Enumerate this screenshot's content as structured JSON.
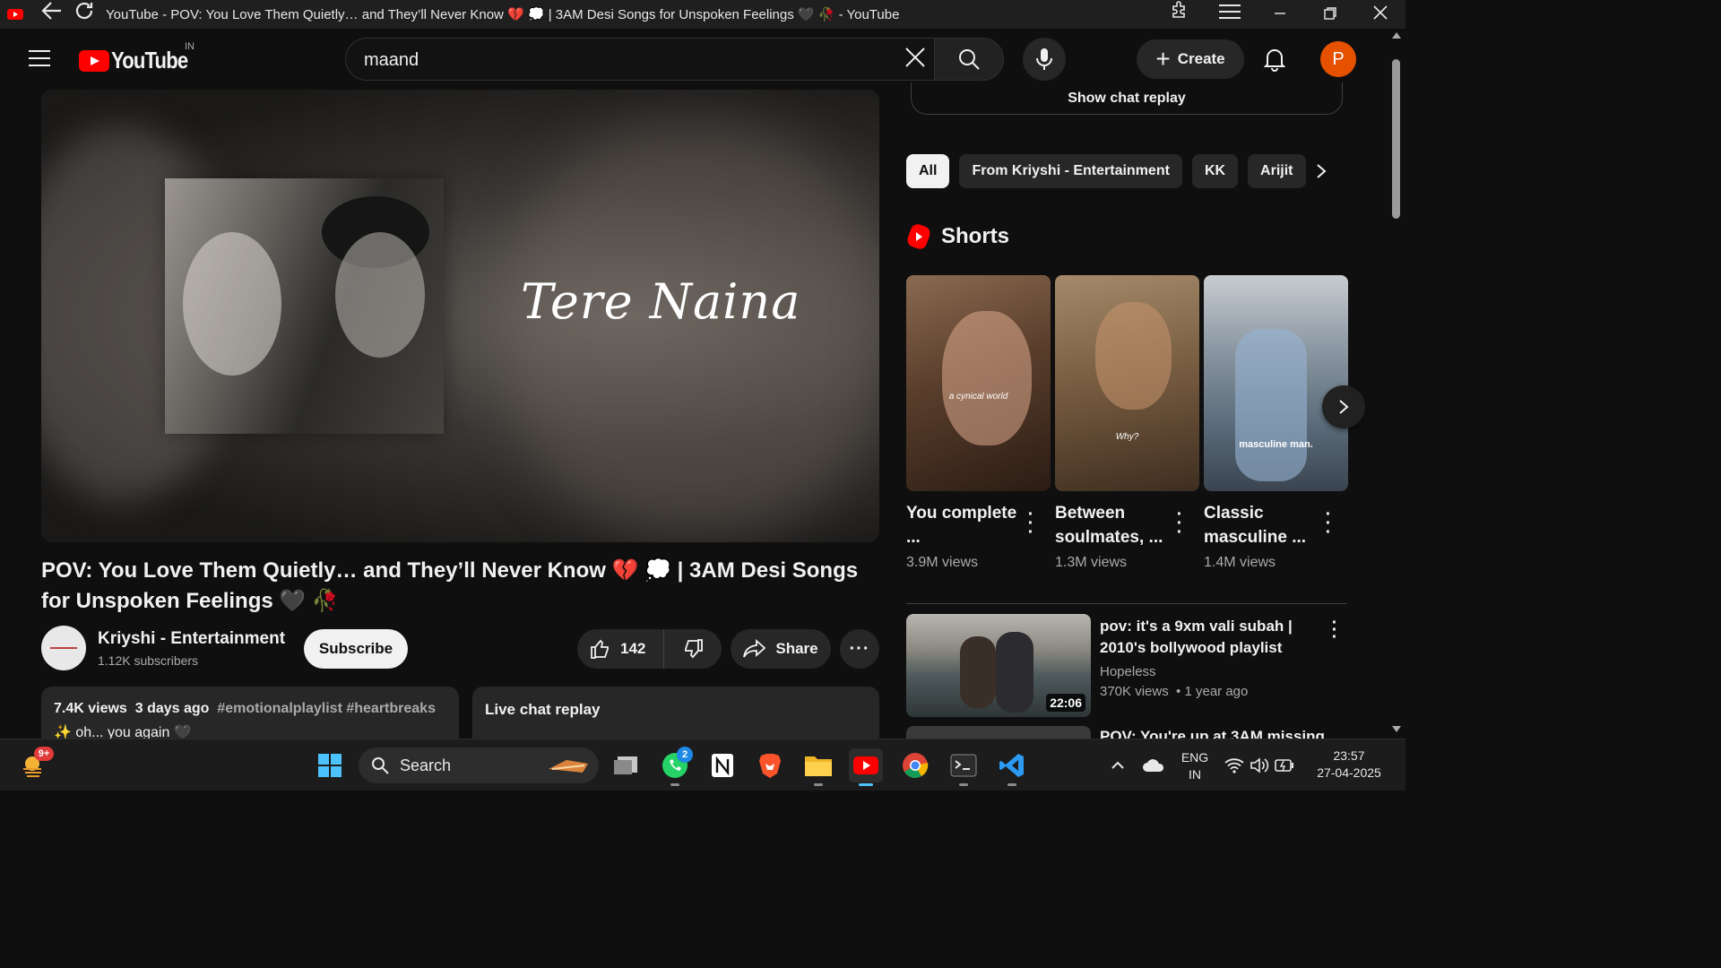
{
  "window": {
    "title": "YouTube - POV: You Love Them Quietly… and They’ll Never Know 💔 💭 | 3AM Desi Songs for Unspoken Feelings 🖤 🥀 - YouTube"
  },
  "header": {
    "logo_text": "YouTube",
    "country": "IN",
    "search_value": "maand",
    "create_label": "Create",
    "avatar_letter": "P"
  },
  "player": {
    "overlay_text": "Tere Naina"
  },
  "video": {
    "title": "POV: You Love Them Quietly… and They’ll Never Know 💔 💭 | 3AM Desi Songs for Unspoken Feelings 🖤 🥀",
    "channel_name": "Kriyshi - Entertainment",
    "subscribers": "1.12K subscribers",
    "subscribe_label": "Subscribe",
    "likes": "142",
    "share_label": "Share",
    "more_label": "···",
    "description": {
      "views": "7.4K views",
      "age": "3 days ago",
      "hashtags": "#emotionalplaylist #heartbreaks",
      "first_line": "✨ oh... you again 🖤"
    },
    "chat_replay_title": "Live chat replay"
  },
  "sidebar": {
    "show_chat_replay": "Show chat replay",
    "chips": [
      "All",
      "From Kriyshi - Entertainment",
      "KK",
      "Arijit"
    ],
    "shorts_heading": "Shorts",
    "shorts": [
      {
        "title": "You complete ...",
        "views": "3.9M views",
        "caption": "a cynical world",
        "color_top": "#7a5a42",
        "color_bottom": "#3c2a1e"
      },
      {
        "title": "Between soulmates, ...",
        "views": "1.3M views",
        "caption": "Why?",
        "color_top": "#9a7a5a",
        "color_bottom": "#5a4632"
      },
      {
        "title": "Classic masculine ...",
        "views": "1.4M views",
        "caption": "masculine man.",
        "color_top": "#aab2b8",
        "color_bottom": "#4a5a68"
      }
    ],
    "recommendations": [
      {
        "title": "pov: it's a 9xm vali subah | 2010's bollywood playlist",
        "channel": "Hopeless",
        "views": "370K views",
        "age": "1 year ago",
        "duration": "22:06"
      },
      {
        "title": "POV: You're up at 3AM missing"
      }
    ]
  },
  "taskbar": {
    "weather_badge": "9+",
    "search_label": "Search",
    "whatsapp_badge": "2",
    "language": "ENG",
    "region": "IN",
    "time": "23:57",
    "date": "27-04-2025"
  }
}
